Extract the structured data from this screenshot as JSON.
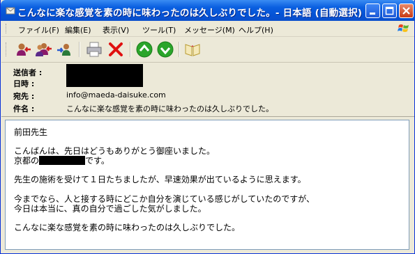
{
  "window": {
    "title": "こんなに楽な感覚を素の時に味わったのは久しぶりでした。- 日本語 (自動選択)",
    "icon": "envelope-icon",
    "controls": [
      "minimize-icon",
      "maximize-icon",
      "close-icon"
    ]
  },
  "menu": {
    "items": [
      "ファイル(F)",
      "編集(E)",
      "表示(V)",
      "ツール(T)",
      "メッセージ(M)",
      "ヘルプ(H)"
    ]
  },
  "toolbar": {
    "buttons": [
      "reply-icon",
      "reply-all-icon",
      "forward-icon",
      "print-icon",
      "delete-icon",
      "previous-icon",
      "next-icon",
      "address-book-icon"
    ]
  },
  "header": {
    "from_label": "送信者 :",
    "date_label": "日時 :",
    "to_label": "宛先 :",
    "to_value": "info@maeda-daisuke.com",
    "subject_label": "件名 :",
    "subject_value": "こんなに楽な感覚を素の時に味わったのは久しぶりでした。"
  },
  "message": {
    "greeting": "前田先生",
    "p1_line1": "こんばんは、先日はどうもありがとう御座いました。",
    "p1_line2_prefix": "京都の",
    "p1_line2_suffix": "です。",
    "p2": "先生の施術を受けて１日たちましたが、早速効果が出ているように思えます。",
    "p3_line1": "今までなら、人と接する時にどこか自分を演じている感じがしていたのですが、",
    "p3_line2": "今日は本当に、真の自分で過ごした気がしました。",
    "p4": "こんなに楽な感覚を素の時に味わったのは久しぶりでした。"
  },
  "colors": {
    "titlebar": "#0553d6",
    "chrome": "#ece9d8",
    "delete_red": "#e01010",
    "nav_green": "#2aa52a"
  }
}
